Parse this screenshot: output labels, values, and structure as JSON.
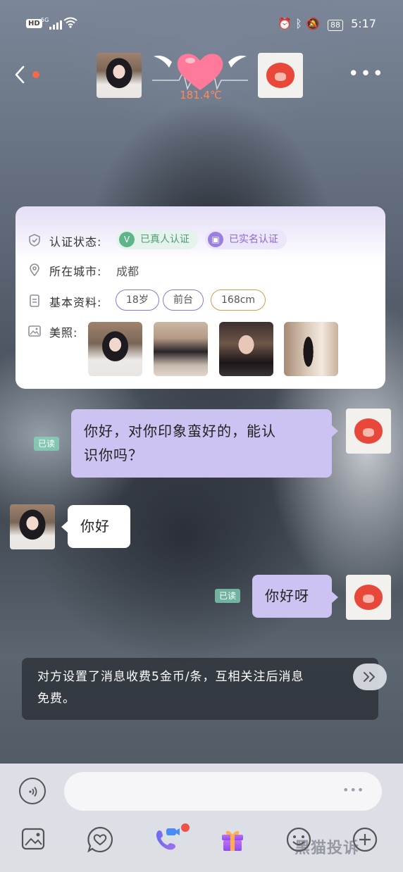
{
  "status_bar": {
    "hd": "HD",
    "network": "5G",
    "battery": "88",
    "time": "5:17",
    "icons": [
      "signal-icon",
      "wifi-icon",
      "alarm-icon",
      "bluetooth-icon",
      "mute-icon"
    ]
  },
  "header": {
    "back_icon": "chevron-left-icon",
    "temperature": "181.4℃",
    "more_icon": "more-dots-icon"
  },
  "profile_card": {
    "verification_label": "认证状态:",
    "badge_real_person": "已真人认证",
    "badge_real_name": "已实名认证",
    "city_label": "所在城市:",
    "city_value": "成都",
    "basic_label": "基本资料:",
    "tags": [
      "18岁",
      "前台",
      "168cm"
    ],
    "photos_label": "美照:",
    "photo_count": 4
  },
  "messages": [
    {
      "side": "right",
      "read": "已读",
      "text_line1": "你好，对你印象蛮好的，能认",
      "text_line2": "识你吗？"
    },
    {
      "side": "left",
      "text": "你好"
    },
    {
      "side": "right",
      "read": "已读",
      "text": "你好呀"
    }
  ],
  "notice": {
    "text_line1": "对方设置了消息收费5金币/条，互相关注后消息",
    "text_line2": "免费。",
    "expand_icon": "double-chevron-right-icon"
  },
  "input": {
    "placeholder": "",
    "more": "•••"
  },
  "toolbar": {
    "icons": [
      "image-icon",
      "heart-chat-icon",
      "video-call-icon",
      "gift-icon",
      "emoji-icon",
      "plus-icon"
    ]
  },
  "watermark": "黑猫投诉",
  "colors": {
    "bubble_self": "#cdc3f2",
    "bubble_other": "#ffffff",
    "read_tag": "#82d7b9",
    "temperature": "#ff8a5b",
    "heart": "#ff7a9a",
    "badge_real": "#5db58a",
    "badge_name": "#9a7fe0"
  }
}
